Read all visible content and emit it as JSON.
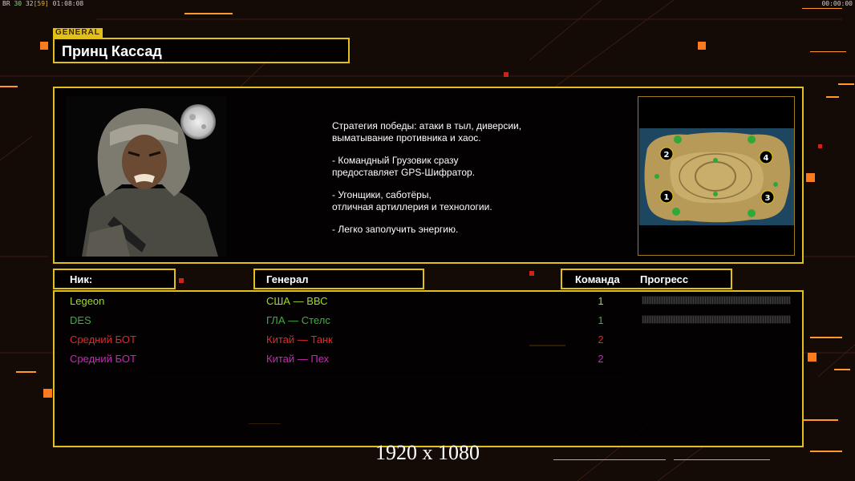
{
  "hud": {
    "left_prefix": "BR",
    "left_green": "30",
    "left_mid": "32",
    "left_bracket": "[59]",
    "left_time": "01:08:08",
    "right_time": "00:00:00"
  },
  "general_tag": "GENERAL",
  "general_name": "Принц Кассад",
  "description": [
    "Стратегия победы: атаки в тыл, диверсии,\n выматывание противника и хаос.",
    "- Командный Грузовик сразу\nпредоставляет GPS-Шифратор.",
    "- Угонщики, саботёры,\nотличная артиллерия и технологии.",
    "- Легко заполучить энергию."
  ],
  "map": {
    "start_positions": [
      "1",
      "2",
      "3",
      "4"
    ]
  },
  "table": {
    "headers": {
      "nick": "Ник:",
      "general": "Генерал",
      "team": "Команда",
      "progress": "Прогресс"
    },
    "rows": [
      {
        "nick": "Legeon",
        "general": "США — ВВС",
        "team": "1",
        "color": "#9ddc2a",
        "has_progress": true
      },
      {
        "nick": "DES",
        "general": "ГЛА — Стелс",
        "team": "1",
        "color": "#3fae3f",
        "has_progress": true
      },
      {
        "nick": "Средний БОТ",
        "general": "Китай — Танк",
        "team": "2",
        "color": "#e0282a",
        "has_progress": false
      },
      {
        "nick": "Средний БОТ",
        "general": "Китай — Пех",
        "team": "2",
        "color": "#c928b8",
        "has_progress": false
      }
    ]
  },
  "resolution_label": "1920 x 1080",
  "colors": {
    "accent": "#e2c01a",
    "orange": "#ff7a1a",
    "background": "#140a06"
  }
}
